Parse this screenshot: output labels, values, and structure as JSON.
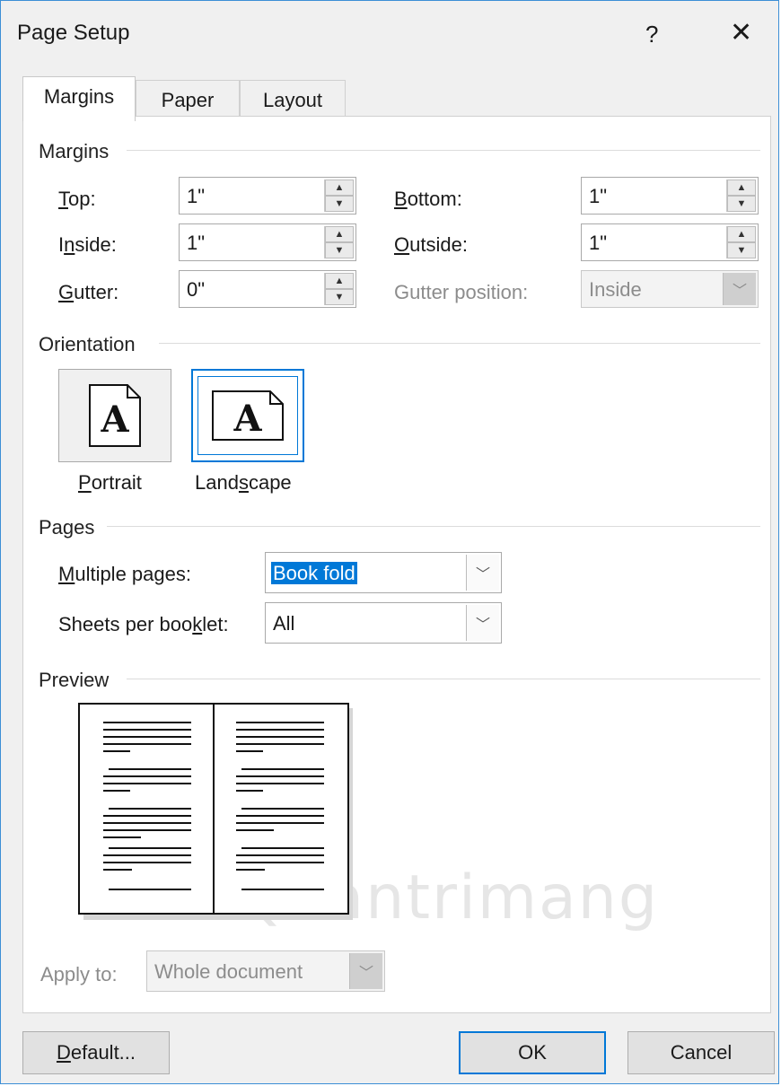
{
  "dialog": {
    "title": "Page Setup",
    "help_icon": "?",
    "close_icon": "✕"
  },
  "tabs": [
    {
      "label": "Margins",
      "active": true
    },
    {
      "label": "Paper",
      "active": false
    },
    {
      "label": "Layout",
      "active": false
    }
  ],
  "margins": {
    "section": "Margins",
    "top": {
      "label_u": "T",
      "label_rest": "op:",
      "value": "1\""
    },
    "bottom": {
      "label_u": "B",
      "label_rest": "ottom:",
      "value": "1\""
    },
    "inside": {
      "label_pre": "I",
      "label_u": "n",
      "label_rest": "side:",
      "value": "1\""
    },
    "outside": {
      "label_u": "O",
      "label_rest": "utside:",
      "value": "1\""
    },
    "gutter": {
      "label_u": "G",
      "label_rest": "utter:",
      "value": "0\""
    },
    "gutter_position": {
      "label": "Gutter position:",
      "value": "Inside"
    }
  },
  "orientation": {
    "section": "Orientation",
    "portrait": {
      "label_u": "P",
      "label_rest": "ortrait",
      "glyph": "A"
    },
    "landscape": {
      "label_pre": "Land",
      "label_u": "s",
      "label_rest": "cape",
      "glyph": "A",
      "selected": true
    }
  },
  "pages": {
    "section": "Pages",
    "multiple": {
      "label_u": "M",
      "label_rest": "ultiple pages:",
      "value": "Book fold"
    },
    "sheets": {
      "label_pre": "Sheets per boo",
      "label_u": "k",
      "label_rest": "let:",
      "value": "All"
    }
  },
  "preview": {
    "section": "Preview"
  },
  "apply_to": {
    "label": "Apply to:",
    "value": "Whole document"
  },
  "buttons": {
    "default": {
      "label_u": "D",
      "label_rest": "efault..."
    },
    "ok": "OK",
    "cancel": "Cancel"
  },
  "watermark": "Quantrimang",
  "colors": {
    "accent": "#0078d7",
    "dialog_bg": "#f0f0f0",
    "border": "#3c8fd6"
  }
}
